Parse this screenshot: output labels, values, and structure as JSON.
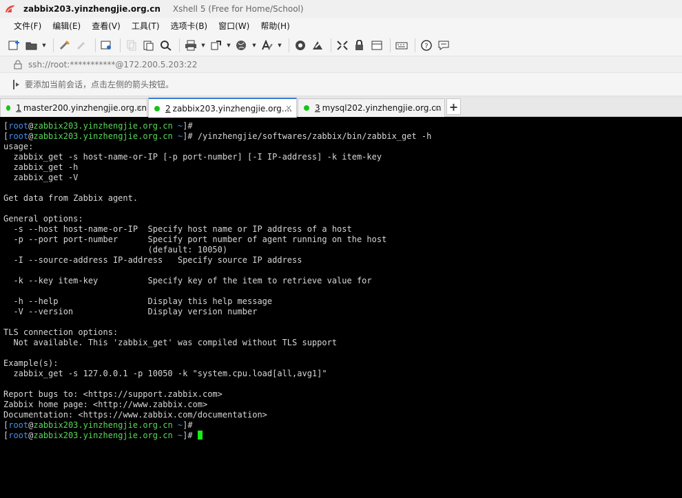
{
  "titlebar": {
    "host": "zabbix203.yinzhengjie.org.cn",
    "app": "Xshell 5 (Free for Home/School)"
  },
  "menu": [
    "文件(F)",
    "编辑(E)",
    "查看(V)",
    "工具(T)",
    "选项卡(B)",
    "窗口(W)",
    "帮助(H)"
  ],
  "address": {
    "url": "ssh://root:***********@172.200.5.203:22"
  },
  "hint": {
    "text": "要添加当前会话，点击左侧的箭头按钮。"
  },
  "tabs": [
    {
      "num": "1",
      "label": "master200.yinzhengjie.org.cn",
      "active": false
    },
    {
      "num": "2",
      "label": "zabbix203.yinzhengjie.org....",
      "active": true
    },
    {
      "num": "3",
      "label": "mysql202.yinzhengjie.org.cn",
      "active": false
    }
  ],
  "tab_add_label": "+",
  "colors": {
    "status_dot": "#17c317",
    "prompt_user": "#4a8fe8",
    "prompt_host": "#58d858",
    "cursor": "#18ee18"
  },
  "prompt": {
    "open": "[",
    "user": "root",
    "at": "@",
    "host": "zabbix203.yinzhengjie.org.cn",
    "path": "~",
    "close": "]#"
  },
  "terminal": {
    "cmd1": "",
    "cmd2": " /yinzhengjie/softwares/zabbix/bin/zabbix_get -h",
    "output": [
      "usage:",
      "  zabbix_get -s host-name-or-IP [-p port-number] [-I IP-address] -k item-key",
      "  zabbix_get -h",
      "  zabbix_get -V",
      "",
      "Get data from Zabbix agent.",
      "",
      "General options:",
      "  -s --host host-name-or-IP  Specify host name or IP address of a host",
      "  -p --port port-number      Specify port number of agent running on the host",
      "                             (default: 10050)",
      "  -I --source-address IP-address   Specify source IP address",
      "",
      "  -k --key item-key          Specify key of the item to retrieve value for",
      "",
      "  -h --help                  Display this help message",
      "  -V --version               Display version number",
      "",
      "TLS connection options:",
      "  Not available. This 'zabbix_get' was compiled without TLS support",
      "",
      "Example(s):",
      "  zabbix_get -s 127.0.0.1 -p 10050 -k \"system.cpu.load[all,avg1]\"",
      "",
      "Report bugs to: <https://support.zabbix.com>",
      "Zabbix home page: <http://www.zabbix.com>",
      "Documentation: <https://www.zabbix.com/documentation>"
    ],
    "cmd3": "",
    "cmd4": " "
  }
}
